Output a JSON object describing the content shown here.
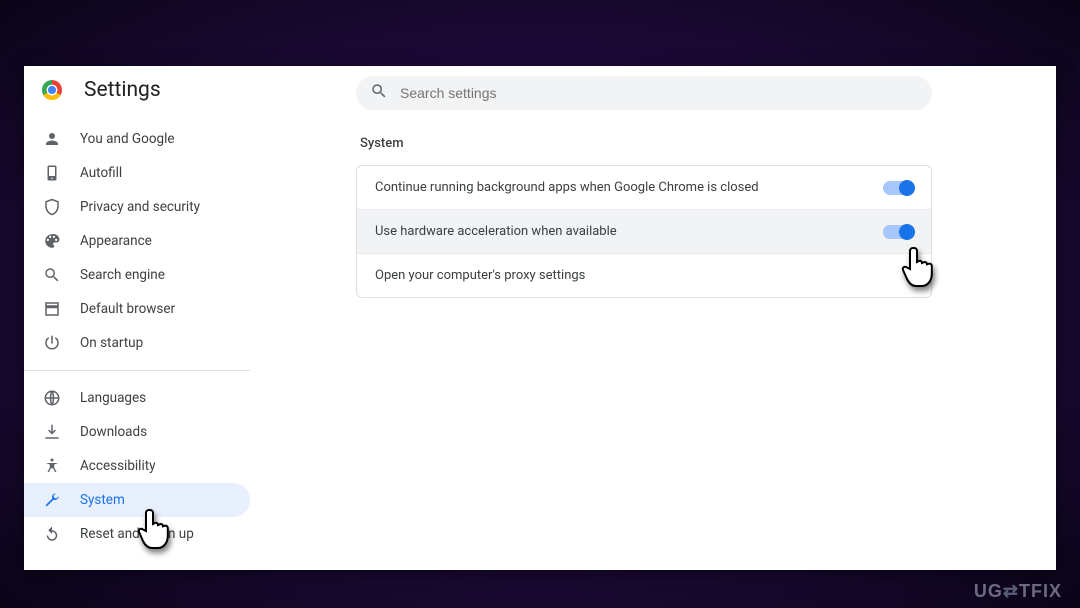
{
  "header": {
    "title": "Settings"
  },
  "search": {
    "placeholder": "Search settings"
  },
  "sidebar": {
    "items": [
      {
        "id": "you-and-google",
        "label": "You and Google",
        "icon": "person"
      },
      {
        "id": "autofill",
        "label": "Autofill",
        "icon": "clipboard"
      },
      {
        "id": "privacy",
        "label": "Privacy and security",
        "icon": "shield"
      },
      {
        "id": "appearance",
        "label": "Appearance",
        "icon": "palette"
      },
      {
        "id": "search-engine",
        "label": "Search engine",
        "icon": "search"
      },
      {
        "id": "default-browser",
        "label": "Default browser",
        "icon": "window"
      },
      {
        "id": "on-startup",
        "label": "On startup",
        "icon": "power"
      }
    ],
    "items2": [
      {
        "id": "languages",
        "label": "Languages",
        "icon": "globe"
      },
      {
        "id": "downloads",
        "label": "Downloads",
        "icon": "download"
      },
      {
        "id": "accessibility",
        "label": "Accessibility",
        "icon": "accessibility"
      },
      {
        "id": "system",
        "label": "System",
        "icon": "wrench",
        "selected": true
      },
      {
        "id": "reset",
        "label": "Reset and clean up",
        "icon": "restore"
      }
    ]
  },
  "main": {
    "section_title": "System",
    "rows": [
      {
        "label": "Continue running background apps when Google Chrome is closed",
        "toggle": "on"
      },
      {
        "label": "Use hardware acceleration when available",
        "toggle": "on",
        "highlight": true
      },
      {
        "label": "Open your computer's proxy settings"
      }
    ]
  },
  "watermark": "UG=TFIX"
}
